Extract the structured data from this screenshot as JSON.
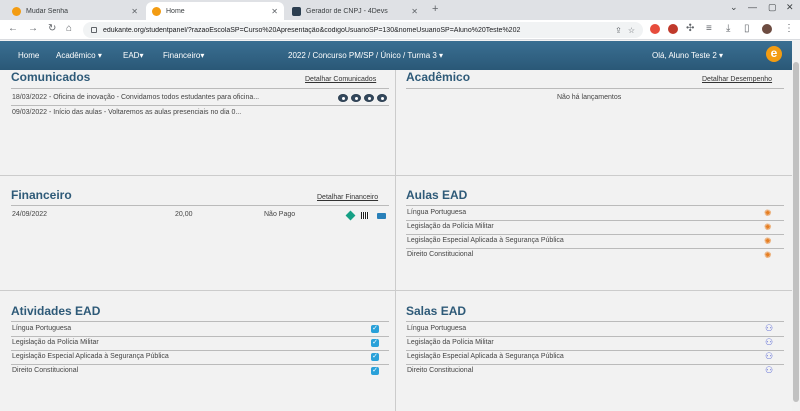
{
  "browser": {
    "tabs": [
      {
        "title": "Mudar Senha",
        "active": false
      },
      {
        "title": "Home",
        "active": true
      },
      {
        "title": "Gerador de CNPJ - 4Devs",
        "active": false
      }
    ],
    "url": "edukante.org/studentpanel/?razaoEscolaSP=Curso%20Apresentação&codigoUsuarioSP=130&nomeUsuarioSP=Aluno%20Teste%202"
  },
  "nav": {
    "home": "Home",
    "academico": "Acadêmico",
    "ead": "EAD",
    "financeiro": "Financeiro",
    "concurso": "2022 / Concurso PM/SP / Único / Turma 3",
    "user": "Olá, Aluno Teste 2",
    "logo": "e"
  },
  "comunicados": {
    "title": "Comunicados",
    "link": "Detalhar Comunicados",
    "items": [
      "18/03/2022 - Oficina de inovação - Convidamos todos estudantes para oficina...",
      "09/03/2022 - Início das aulas - Voltaremos as aulas presenciais no dia 0..."
    ]
  },
  "academico": {
    "title": "Acadêmico",
    "link": "Detalhar Desempenho",
    "empty": "Não há lançamentos"
  },
  "financeiro": {
    "title": "Financeiro",
    "link": "Detalhar Financeiro",
    "row": {
      "date": "24/09/2022",
      "value": "20,00",
      "status": "Não Pago"
    }
  },
  "aulas_ead": {
    "title": "Aulas EAD",
    "items": [
      "Língua Portuguesa",
      "Legislação da Polícia Militar",
      "Legislação Especial Aplicada à Segurança Pública",
      "Direito Constitucional"
    ]
  },
  "atividades_ead": {
    "title": "Atividades EAD",
    "items": [
      "Língua Portuguesa",
      "Legislação da Polícia Militar",
      "Legislação Especial Aplicada à Segurança Pública",
      "Direito Constitucional"
    ]
  },
  "salas_ead": {
    "title": "Salas EAD",
    "items": [
      "Língua Portuguesa",
      "Legislação da Polícia Militar",
      "Legislação Especial Aplicada à Segurança Pública",
      "Direito Constitucional"
    ]
  }
}
